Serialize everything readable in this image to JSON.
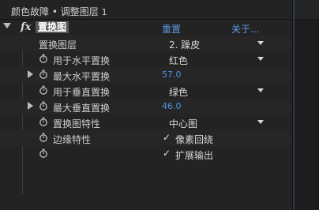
{
  "tab": {
    "panel_name": "颜色故障",
    "separator": "•",
    "layer_name": "调整图层",
    "layer_index": "1"
  },
  "effect": {
    "fx_label": "fx",
    "name": "置换图",
    "reset_label": "重置",
    "about_label": "关于..."
  },
  "params": {
    "map_layer": {
      "label": "置换图层",
      "value": "2. 躁皮"
    },
    "use_horizontal": {
      "label": "用于水平置换",
      "value": "红色"
    },
    "max_horizontal": {
      "label": "最大水平置换",
      "value": "57.0"
    },
    "use_vertical": {
      "label": "用于垂直置换",
      "value": "绿色"
    },
    "max_vertical": {
      "label": "最大垂直置换",
      "value": "46.0"
    },
    "map_behavior": {
      "label": "置换图特性",
      "value": "中心图"
    },
    "edge_behavior": {
      "label": "边缘特性",
      "wrap_label": "像素回绕",
      "wrap_checked": true
    },
    "expand_output": {
      "label": "扩展输出",
      "checked": true
    }
  },
  "icons": {
    "stopwatch": "stopwatch-icon",
    "checkmark": "✓"
  }
}
